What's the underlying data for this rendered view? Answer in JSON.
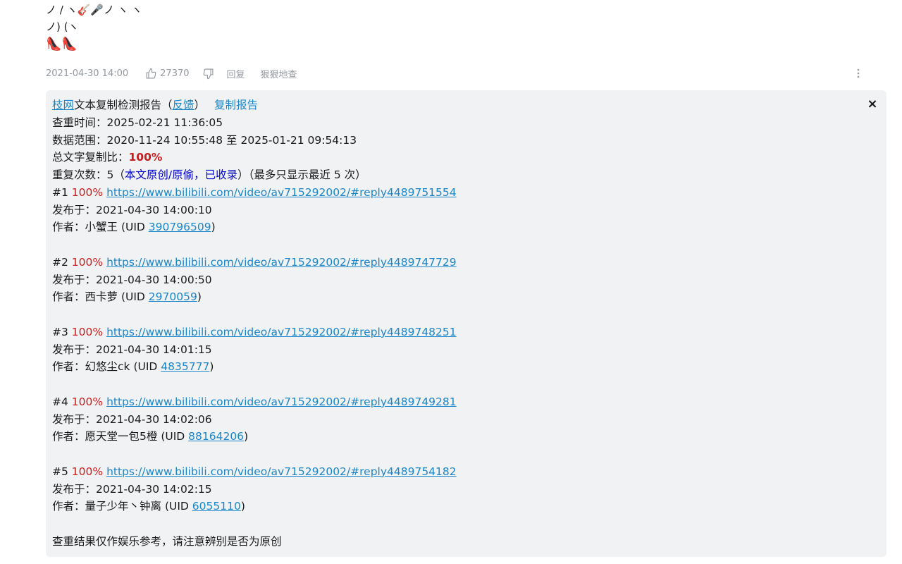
{
  "comment": {
    "art_line_1": "ノ / ヽ",
    "art_line_1_end": "ノ ヽ ヽ",
    "art_line_2": "ノ) (ヽ",
    "time": "2021-04-30 14:00",
    "like_count": "27370",
    "reply_label": "回复",
    "check_label": "狠狠地查"
  },
  "report": {
    "brand": "枝网",
    "title_text": "文本复制检测报告（",
    "feedback": "反馈",
    "title_close": "）",
    "copy_report": "复制报告",
    "close_symbol": "×",
    "check_time_label": "查重时间：",
    "check_time": "2025-02-21 11:36:05",
    "range_label": "数据范围：",
    "range": "2020-11-24 10:55:48 至 2025-01-21 09:54:13",
    "ratio_label": "总文字复制比：",
    "ratio": "100%",
    "repeat_label": "重复次数：",
    "repeat_count": "5",
    "repeat_open": "（",
    "repeat_note": "本文原创/原偷，已收录",
    "repeat_close": "）",
    "repeat_tail": "（最多只显示最近 5 次）",
    "published_label": "发布于：",
    "author_label": "作者：",
    "uid_open": "(UID ",
    "uid_close": ")",
    "entries": [
      {
        "index": "#1",
        "percent": "100%",
        "url": "https://www.bilibili.com/video/av715292002/#reply4489751554",
        "published": "2021-04-30 14:00:10",
        "author": "小蟹王",
        "uid": "390796509"
      },
      {
        "index": "#2",
        "percent": "100%",
        "url": "https://www.bilibili.com/video/av715292002/#reply4489747729",
        "published": "2021-04-30 14:00:50",
        "author": "西卡萝",
        "uid": "2970059"
      },
      {
        "index": "#3",
        "percent": "100%",
        "url": "https://www.bilibili.com/video/av715292002/#reply4489748251",
        "published": "2021-04-30 14:01:15",
        "author": "幻悠尘ck",
        "uid": "4835777"
      },
      {
        "index": "#4",
        "percent": "100%",
        "url": "https://www.bilibili.com/video/av715292002/#reply4489749281",
        "published": "2021-04-30 14:02:06",
        "author": "愿天堂一包5橙",
        "uid": "88164206"
      },
      {
        "index": "#5",
        "percent": "100%",
        "url": "https://www.bilibili.com/video/av715292002/#reply4489754182",
        "published": "2021-04-30 14:02:15",
        "author": "量子少年丶钟离",
        "uid": "6055110"
      }
    ],
    "disclaimer": "查重结果仅作娱乐参考，请注意辨别是否为原创"
  },
  "colors": {
    "link": "#1b86c9",
    "highlight_red": "#c81d1d",
    "note_blue": "#0000cc",
    "report_bg": "#f1f2f3",
    "meta_gray": "#9499a0"
  },
  "icons": [
    "guitar-icon",
    "microphone-icon",
    "high-heel-icon",
    "thumbs-up-icon",
    "thumbs-down-icon",
    "more-vertical-icon",
    "close-icon"
  ]
}
